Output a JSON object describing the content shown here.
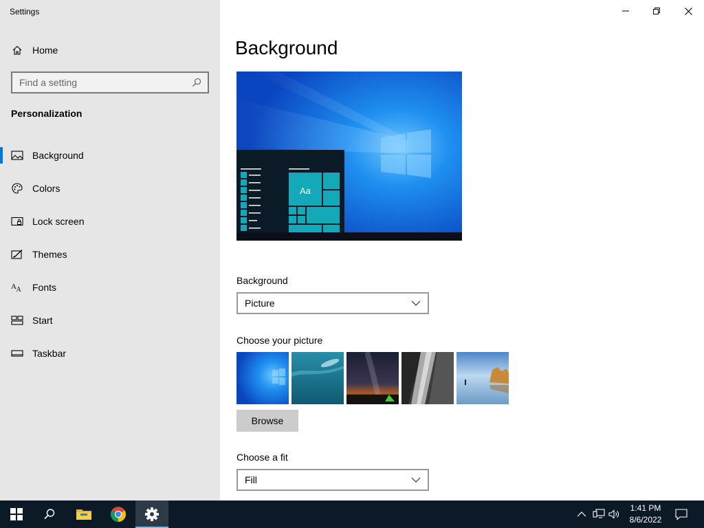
{
  "app": {
    "title": "Settings"
  },
  "sidebar": {
    "home_label": "Home",
    "search_placeholder": "Find a setting",
    "section_title": "Personalization",
    "items": [
      {
        "label": "Background",
        "icon": "picture-icon",
        "active": true
      },
      {
        "label": "Colors",
        "icon": "palette-icon"
      },
      {
        "label": "Lock screen",
        "icon": "lock-screen-icon"
      },
      {
        "label": "Themes",
        "icon": "themes-icon"
      },
      {
        "label": "Fonts",
        "icon": "fonts-icon"
      },
      {
        "label": "Start",
        "icon": "start-icon"
      },
      {
        "label": "Taskbar",
        "icon": "taskbar-icon"
      }
    ]
  },
  "main": {
    "title": "Background",
    "preview_tile_text": "Aa",
    "background_label": "Background",
    "background_value": "Picture",
    "choose_picture_label": "Choose your picture",
    "browse_label": "Browse",
    "fit_label": "Choose a fit",
    "fit_value": "Fill"
  },
  "taskbar": {
    "time": "1:41 PM",
    "date": "8/6/2022",
    "apps": [
      "start-icon",
      "search-icon",
      "file-explorer-icon",
      "chrome-icon",
      "settings-icon"
    ]
  },
  "colors": {
    "accent": "#0078d7",
    "sidebar_bg": "#e6e6e6",
    "taskbar_bg": "#0c1926",
    "tile": "#14a9b9"
  }
}
